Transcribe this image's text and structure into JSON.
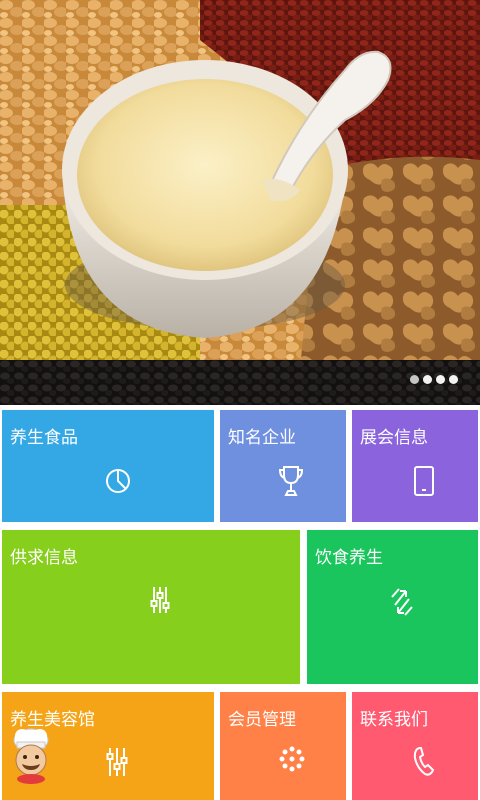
{
  "banner": {
    "slides": 4,
    "active_slide": 1
  },
  "tiles": [
    {
      "label": "养生食品",
      "icon": "pie-chart-icon",
      "color": "#33a8e4"
    },
    {
      "label": "知名企业",
      "icon": "trophy-icon",
      "color": "#6f8fdf"
    },
    {
      "label": "展会信息",
      "icon": "tablet-icon",
      "color": "#8a63dd"
    },
    {
      "label": "供求信息",
      "icon": "sliders-icon",
      "color": "#86cf1d"
    },
    {
      "label": "饮食养生",
      "icon": "refresh-icon",
      "color": "#1bc55d"
    },
    {
      "label": "养生美容馆",
      "icon": "equalizer-icon",
      "color": "#f5a418"
    },
    {
      "label": "会员管理",
      "icon": "dots-circle-icon",
      "color": "#ff8147"
    },
    {
      "label": "联系我们",
      "icon": "phone-icon",
      "color": "#ff5a70"
    }
  ],
  "floating": {
    "icon": "chef-avatar-icon"
  }
}
